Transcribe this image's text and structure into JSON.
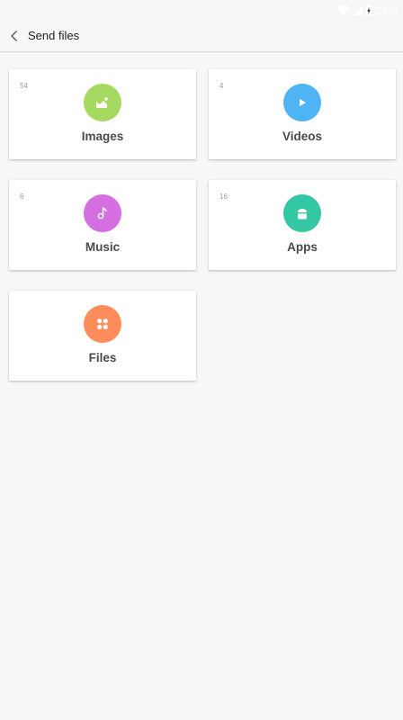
{
  "status_bar": {
    "time": "2:09",
    "icons": [
      "wifi-icon",
      "signal-icon",
      "battery-charging-icon"
    ]
  },
  "header": {
    "back_icon": "chevron-left-icon",
    "title": "Send files"
  },
  "categories": [
    {
      "label": "Images",
      "count": "54",
      "color": "#a6d95f",
      "icon": "image-icon"
    },
    {
      "label": "Videos",
      "count": "4",
      "color": "#4fb4f3",
      "icon": "play-icon"
    },
    {
      "label": "Music",
      "count": "6",
      "color": "#d56ee0",
      "icon": "music-note-icon"
    },
    {
      "label": "Apps",
      "count": "16",
      "color": "#33c7a3",
      "icon": "android-icon"
    },
    {
      "label": "Files",
      "color": "#ff8c5a",
      "icon": "grid-dots-icon"
    }
  ]
}
